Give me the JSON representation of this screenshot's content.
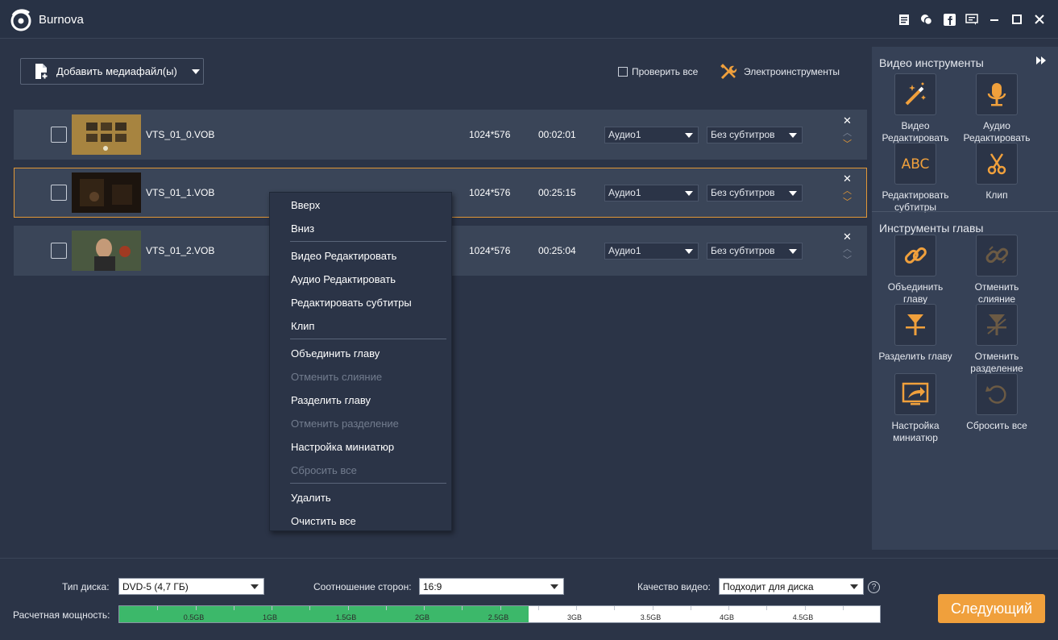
{
  "app": {
    "title": "Burnova"
  },
  "toolbar": {
    "add_media_label": "Добавить медиафайл(ы)",
    "check_all_label": "Проверить все",
    "power_tools_label": "Электроинструменты"
  },
  "files": [
    {
      "name": "VTS_01_0.VOB",
      "resolution": "1024*576",
      "duration": "00:02:01",
      "audio": "Аудио1",
      "subtitle": "Без субтитров",
      "selected": false
    },
    {
      "name": "VTS_01_1.VOB",
      "resolution": "1024*576",
      "duration": "00:25:15",
      "audio": "Аудио1",
      "subtitle": "Без субтитров",
      "selected": true
    },
    {
      "name": "VTS_01_2.VOB",
      "resolution": "1024*576",
      "duration": "00:25:04",
      "audio": "Аудио1",
      "subtitle": "Без субтитров",
      "selected": false
    }
  ],
  "context_menu": {
    "up": "Вверх",
    "down": "Вниз",
    "video_edit": "Видео Редактировать",
    "audio_edit": "Аудио Редактировать",
    "subtitle_edit": "Редактировать субтитры",
    "clip": "Клип",
    "merge_chapter": "Объединить главу",
    "cancel_merge": "Отменить слияние",
    "split_chapter": "Разделить главу",
    "cancel_split": "Отменить разделение",
    "thumbnail_settings": "Настройка миниатюр",
    "reset_all": "Сбросить все",
    "delete": "Удалить",
    "clear_all": "Очистить все"
  },
  "right_panel": {
    "video_tools_title": "Видео инструменты",
    "chapter_tools_title": "Инструменты главы",
    "video_tools": [
      {
        "label_1": "Видео",
        "label_2": "Редактировать",
        "icon": "magic-wand-icon"
      },
      {
        "label_1": "Аудио",
        "label_2": "Редактировать",
        "icon": "microphone-icon"
      },
      {
        "label_1": "Редактировать",
        "label_2": "субтитры",
        "icon": "abc-icon"
      },
      {
        "label_1": "Клип",
        "label_2": "",
        "icon": "scissors-icon"
      }
    ],
    "chapter_tools": [
      {
        "label_1": "Объединить",
        "label_2": "главу",
        "icon": "link-icon"
      },
      {
        "label_1": "Отменить",
        "label_2": "слияние",
        "icon": "broken-link-icon"
      },
      {
        "label_1": "Разделить главу",
        "label_2": "",
        "icon": "split-icon"
      },
      {
        "label_1": "Отменить",
        "label_2": "разделение",
        "icon": "cancel-split-icon"
      },
      {
        "label_1": "Настройка",
        "label_2": "миниатюр",
        "icon": "thumbnail-icon"
      },
      {
        "label_1": "Сбросить все",
        "label_2": "",
        "icon": "reset-icon"
      }
    ]
  },
  "footer": {
    "disc_type_label": "Тип диска:",
    "disc_type_value": "DVD-5 (4,7 ГБ)",
    "aspect_label": "Соотношение сторон:",
    "aspect_value": "16:9",
    "quality_label": "Качество видео:",
    "quality_value": "Подходит для диска",
    "capacity_label": "Расчетная мощность:",
    "capacity_fill_fraction": 0.538,
    "capacity_ticks": [
      "0.5GB",
      "1GB",
      "1.5GB",
      "2GB",
      "2.5GB",
      "3GB",
      "3.5GB",
      "4GB",
      "4.5GB"
    ],
    "next_label": "Следующий"
  },
  "colors": {
    "accent": "#f0a03c",
    "capacity_fill": "#3cb86a",
    "selected_border": "#e29736"
  }
}
